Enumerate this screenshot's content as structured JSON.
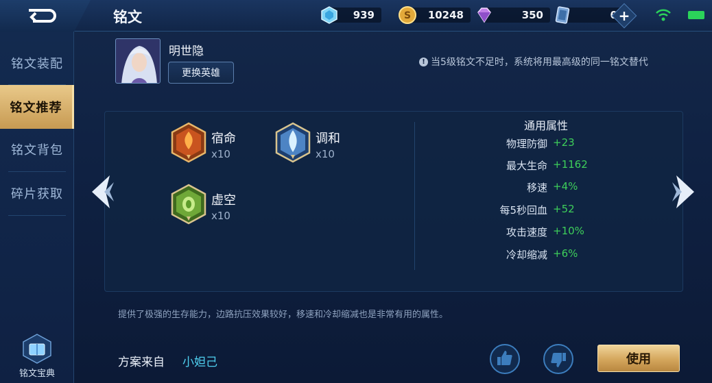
{
  "header": {
    "title": "铭文",
    "resources": [
      {
        "icon": "diamond-icon",
        "value": "939"
      },
      {
        "icon": "gold-coin-icon",
        "value": "10248"
      },
      {
        "icon": "crystal-icon",
        "value": "350"
      },
      {
        "icon": "ticket-card-icon",
        "value": "0"
      }
    ],
    "plus_label": "+"
  },
  "sidebar": {
    "items": [
      {
        "label": "铭文装配",
        "active": false
      },
      {
        "label": "铭文推荐",
        "active": true
      },
      {
        "label": "铭文背包",
        "active": false
      },
      {
        "label": "碎片获取",
        "active": false
      }
    ],
    "codex_label": "铭文宝典"
  },
  "hero": {
    "name": "明世隐",
    "change_button": "更换英雄"
  },
  "notice": {
    "icon": "!",
    "text": "当5级铭文不足时，系统将用最高级的同一铭文替代"
  },
  "runes": [
    {
      "name": "宿命",
      "count": "x10",
      "color": "red"
    },
    {
      "name": "调和",
      "count": "x10",
      "color": "blue"
    },
    {
      "name": "虚空",
      "count": "x10",
      "color": "green"
    }
  ],
  "stats": {
    "title": "通用属性",
    "rows": [
      {
        "name": "物理防御",
        "value": "+23"
      },
      {
        "name": "最大生命",
        "value": "+1162"
      },
      {
        "name": "移速",
        "value": "+4%"
      },
      {
        "name": "每5秒回血",
        "value": "+52"
      },
      {
        "name": "攻击速度",
        "value": "+10%"
      },
      {
        "name": "冷却缩减",
        "value": "+6%"
      }
    ]
  },
  "description": "提供了极强的生存能力，边路抗压效果较好，移速和冷却缩减也是非常有用的属性。",
  "source": {
    "label": "方案来自",
    "author": "小妲己"
  },
  "actions": {
    "use_button": "使用"
  },
  "colors": {
    "accent_gold": "#d4a65c",
    "stat_green": "#3ecf5a",
    "author_cyan": "#4fd0f0"
  }
}
